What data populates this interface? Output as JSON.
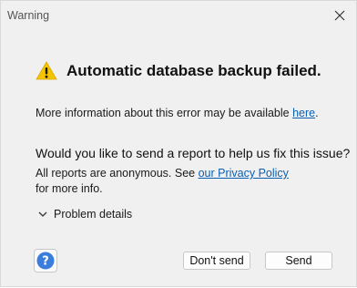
{
  "window": {
    "title": "Warning"
  },
  "icons": {
    "close": "close-icon",
    "warning": "warning-icon",
    "help": "help-icon",
    "chevron": "chevron-down-icon"
  },
  "message": {
    "headline": "Automatic database backup failed.",
    "info_prefix": "More information about this error may be available ",
    "info_link": "here",
    "info_suffix": ".",
    "question": "Would you like to send a report to help us fix this issue?",
    "anon_prefix": "All reports are anonymous. See ",
    "privacy_link": "our Privacy Policy",
    "anon_suffix": " for more info."
  },
  "details": {
    "label": "Problem details"
  },
  "buttons": {
    "dont_send": "Don't send",
    "send": "Send"
  },
  "colors": {
    "link": "#0a5fb0",
    "warning_fill": "#f5c400",
    "help_fill": "#3b7ddd"
  }
}
